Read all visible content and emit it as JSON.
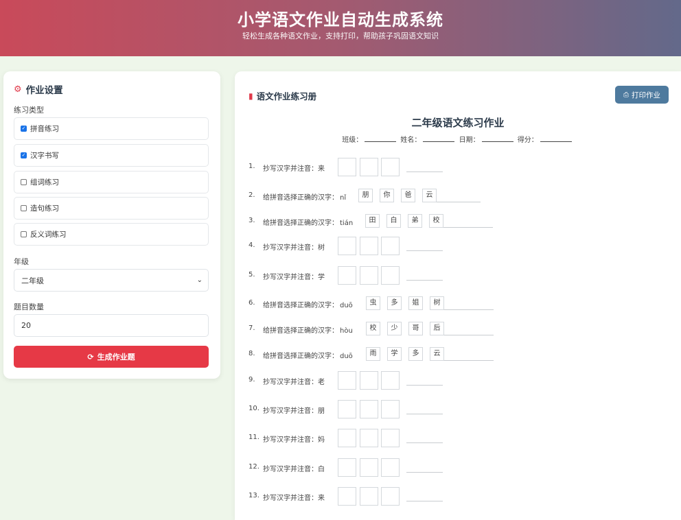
{
  "header": {
    "title": "小学语文作业自动生成系统",
    "subtitle": "轻松生成各种语文作业，支持打印，帮助孩子巩固语文知识"
  },
  "settings": {
    "title": "作业设置",
    "title_icon": "gears-icon",
    "type_label": "练习类型",
    "types": [
      {
        "label": "拼音练习",
        "checked": true
      },
      {
        "label": "汉字书写",
        "checked": true
      },
      {
        "label": "组词练习",
        "checked": false
      },
      {
        "label": "造句练习",
        "checked": false
      },
      {
        "label": "反义词练习",
        "checked": false
      }
    ],
    "grade_label": "年级",
    "grade_value": "二年级",
    "count_label": "题目数量",
    "count_value": "20",
    "generate_label": "生成作业题",
    "generate_icon": "refresh-icon"
  },
  "workbook": {
    "title": "语文作业练习册",
    "title_icon": "book-icon",
    "print_label": "打印作业",
    "print_icon": "printer-icon",
    "hw_title": "二年级语文练习作业",
    "meta": {
      "class": "班级：",
      "name": "姓名：",
      "date": "日期：",
      "score": "得分："
    },
    "questions": [
      {
        "num": "1.",
        "text": "抄写汉字并注音：来",
        "kind": "copy"
      },
      {
        "num": "2.",
        "text": "给拼音选择正确的汉字：",
        "pinyin": "nǐ",
        "kind": "choice",
        "options": [
          "朋",
          "你",
          "爸",
          "云"
        ]
      },
      {
        "num": "3.",
        "text": "给拼音选择正确的汉字：",
        "pinyin": "tián",
        "kind": "choice",
        "options": [
          "田",
          "白",
          "弟",
          "校"
        ]
      },
      {
        "num": "4.",
        "text": "抄写汉字并注音：树",
        "kind": "copy"
      },
      {
        "num": "5.",
        "text": "抄写汉字并注音：学",
        "kind": "copy"
      },
      {
        "num": "6.",
        "text": "给拼音选择正确的汉字：",
        "pinyin": "duō",
        "kind": "choice",
        "options": [
          "虫",
          "多",
          "姐",
          "树"
        ]
      },
      {
        "num": "7.",
        "text": "给拼音选择正确的汉字：",
        "pinyin": "hòu",
        "kind": "choice",
        "options": [
          "校",
          "少",
          "哥",
          "后"
        ]
      },
      {
        "num": "8.",
        "text": "给拼音选择正确的汉字：",
        "pinyin": "duō",
        "kind": "choice",
        "options": [
          "雨",
          "学",
          "多",
          "云"
        ]
      },
      {
        "num": "9.",
        "text": "抄写汉字并注音：老",
        "kind": "copy"
      },
      {
        "num": "10.",
        "text": "抄写汉字并注音：朋",
        "kind": "copy"
      },
      {
        "num": "11.",
        "text": "抄写汉字并注音：妈",
        "kind": "copy"
      },
      {
        "num": "12.",
        "text": "抄写汉字并注音：白",
        "kind": "copy"
      },
      {
        "num": "13.",
        "text": "抄写汉字并注音：来",
        "kind": "copy"
      }
    ]
  }
}
